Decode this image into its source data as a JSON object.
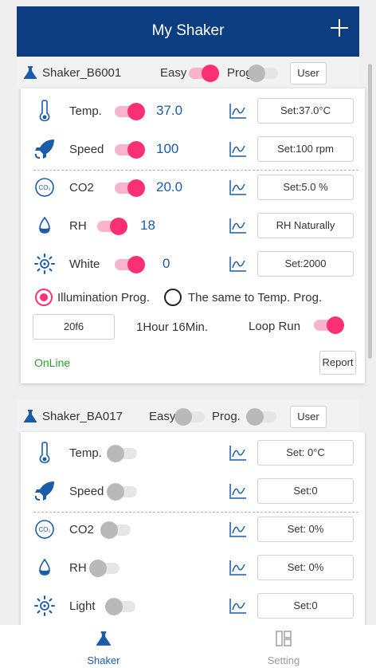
{
  "header": {
    "title": "My Shaker"
  },
  "shaker1": {
    "name": "Shaker_B6001",
    "easy_label": "Easy",
    "prog_label": "Prog.",
    "user_label": "User",
    "rows": [
      {
        "label": "Temp.",
        "value": "37.0",
        "set": "Set:37.0°C"
      },
      {
        "label": "Speed",
        "value": "100",
        "set": "Set:100 rpm"
      },
      {
        "label": "CO2",
        "value": "20.0",
        "set": "Set:5.0 %"
      },
      {
        "label": "RH",
        "value": "18",
        "set": "RH Naturally"
      },
      {
        "label": "White",
        "value": "0",
        "set": "Set:2000"
      }
    ],
    "illumination_prog": "Illumination Prog.",
    "same_to_temp": "The same to Temp. Prog.",
    "prog_step": "20f6",
    "duration": "1Hour 16Min.",
    "loop_run": "Loop Run",
    "status": "OnLine",
    "report_label": "Report"
  },
  "shaker2": {
    "name": "Shaker_BA017",
    "easy_label": "Easy",
    "prog_label": "Prog.",
    "user_label": "User",
    "rows": [
      {
        "label": "Temp.",
        "set": "Set: 0°C"
      },
      {
        "label": "Speed",
        "set": "Set:0"
      },
      {
        "label": "CO2",
        "set": "Set: 0%"
      },
      {
        "label": "RH",
        "set": "Set: 0%"
      },
      {
        "label": "Light",
        "set": "Set:0"
      }
    ]
  },
  "tabs": [
    {
      "label": "Shaker",
      "active": true
    },
    {
      "label": "Setting",
      "active": false
    }
  ],
  "colors": {
    "header": "#0c3d80",
    "accent": "#ff2f73",
    "value": "#1a5ca8",
    "online": "#2aa02a"
  }
}
